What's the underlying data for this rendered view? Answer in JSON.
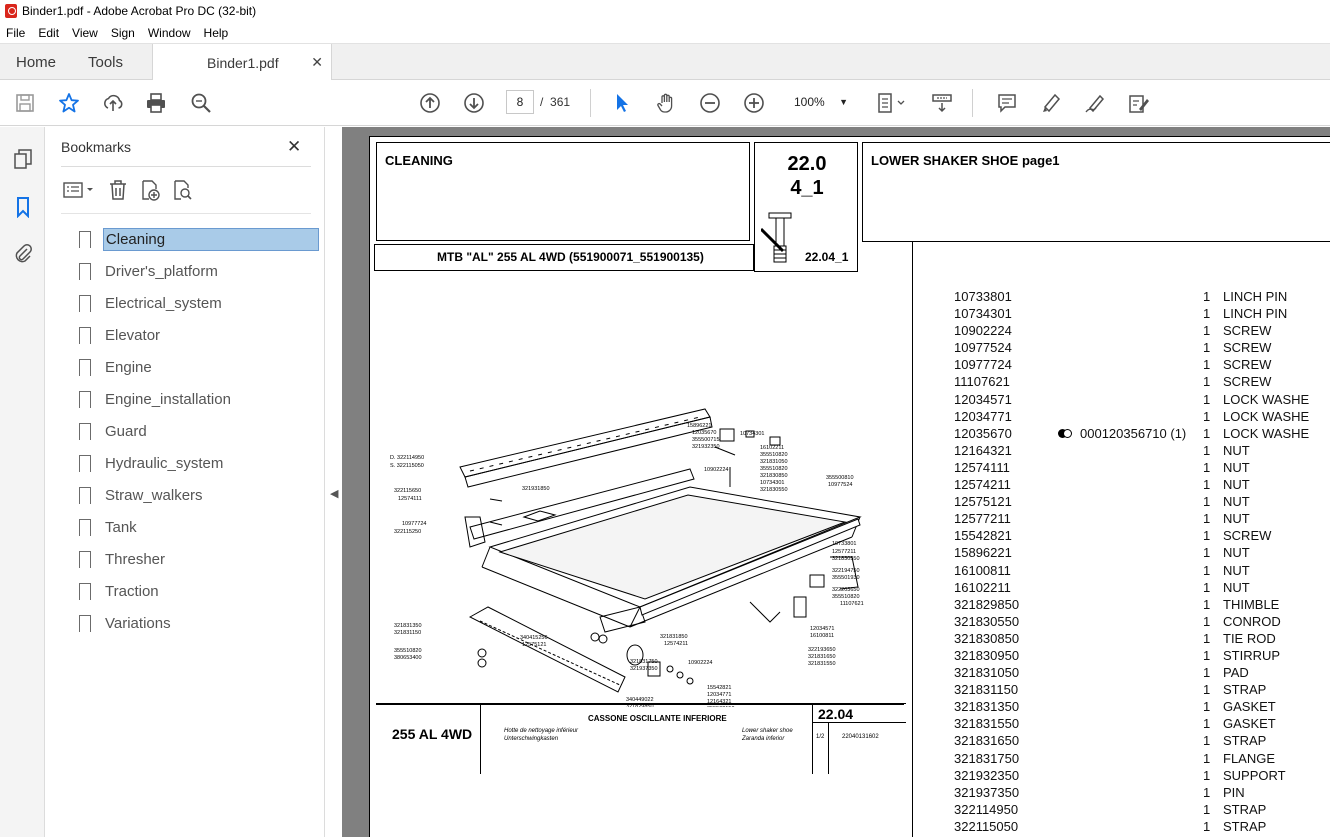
{
  "window": {
    "title": "Binder1.pdf - Adobe Acrobat Pro DC (32-bit)"
  },
  "menu": [
    "File",
    "Edit",
    "View",
    "Sign",
    "Window",
    "Help"
  ],
  "tabs": {
    "home": "Home",
    "tools": "Tools",
    "doc": "Binder1.pdf"
  },
  "toolbar": {
    "page_current": "8",
    "page_sep": "/",
    "page_total": "361",
    "zoom": "100%"
  },
  "bookmarks": {
    "title": "Bookmarks",
    "items": [
      "Cleaning",
      "Driver's_platform",
      "Electrical_system",
      "Elevator",
      "Engine",
      "Engine_installation",
      "Guard",
      "Hydraulic_system",
      "Straw_walkers",
      "Tank",
      "Thresher",
      "Traction",
      "Variations"
    ],
    "selected": 0
  },
  "page": {
    "group": "CLEANING",
    "model_line": "MTB \"AL\" 255 AL 4WD (551900071_551900135)",
    "section_num_1": "22.0",
    "section_num_2": "4_1",
    "section_ref": "22.04_1",
    "assembly": "LOWER SHAKER SHOE  page1",
    "caption": {
      "model": "255 AL 4WD",
      "title": "CASSONE OSCILLANTE INFERIORE",
      "fr": "Hotte de nettoyage inférieur",
      "de": "Unterschwingkasten",
      "en": "Lower shaker shoe",
      "es": "Zaranda inferior",
      "sec": "22.04",
      "sheet": "1/2",
      "code": "22040131602"
    },
    "drawing_labels": [
      "D. 322114950",
      "S. 322115050",
      "15896221",
      "12035670",
      "355500715",
      "321932350",
      "10734301",
      "16102211",
      "355510820",
      "321831050",
      "355510820",
      "321830850",
      "10734301",
      "321830550",
      "10902224",
      "321931850",
      "322115650",
      "12574111",
      "10977724",
      "322115250",
      "355500810",
      "10977524",
      "10733801",
      "12577211",
      "321830550",
      "322194750",
      "355501930",
      "322203650",
      "355510820",
      "11107621",
      "321831350",
      "321831150",
      "355510820",
      "380653400",
      "340415256",
      "12575121",
      "321831850",
      "12574211",
      "321831750",
      "321937350",
      "10902224",
      "12034571",
      "16100811",
      "322193650",
      "321831650",
      "321831550",
      "15542821",
      "12034771",
      "12164321",
      "355502150",
      "340449022",
      "321829850"
    ]
  },
  "parts": [
    {
      "code": "10733801",
      "alt": "",
      "qty": "1",
      "desc": "LINCH PIN"
    },
    {
      "code": "10734301",
      "alt": "",
      "qty": "1",
      "desc": "LINCH PIN"
    },
    {
      "code": "10902224",
      "alt": "",
      "qty": "1",
      "desc": "SCREW"
    },
    {
      "code": "10977524",
      "alt": "",
      "qty": "1",
      "desc": "SCREW"
    },
    {
      "code": "10977724",
      "alt": "",
      "qty": "1",
      "desc": "SCREW"
    },
    {
      "code": "11107621",
      "alt": "",
      "qty": "1",
      "desc": "SCREW"
    },
    {
      "code": "12034571",
      "alt": "",
      "qty": "1",
      "desc": "LOCK WASHE"
    },
    {
      "code": "12034771",
      "alt": "",
      "qty": "1",
      "desc": "LOCK WASHE"
    },
    {
      "code": "12035670",
      "alt": "000120356710  (1)",
      "qty": "1",
      "desc": "LOCK WASHE"
    },
    {
      "code": "12164321",
      "alt": "",
      "qty": "1",
      "desc": "NUT"
    },
    {
      "code": "12574111",
      "alt": "",
      "qty": "1",
      "desc": "NUT"
    },
    {
      "code": "12574211",
      "alt": "",
      "qty": "1",
      "desc": "NUT"
    },
    {
      "code": "12575121",
      "alt": "",
      "qty": "1",
      "desc": "NUT"
    },
    {
      "code": "12577211",
      "alt": "",
      "qty": "1",
      "desc": "NUT"
    },
    {
      "code": "15542821",
      "alt": "",
      "qty": "1",
      "desc": "SCREW"
    },
    {
      "code": "15896221",
      "alt": "",
      "qty": "1",
      "desc": "NUT"
    },
    {
      "code": "16100811",
      "alt": "",
      "qty": "1",
      "desc": "NUT"
    },
    {
      "code": "16102211",
      "alt": "",
      "qty": "1",
      "desc": "NUT"
    },
    {
      "code": "321829850",
      "alt": "",
      "qty": "1",
      "desc": "THIMBLE"
    },
    {
      "code": "321830550",
      "alt": "",
      "qty": "1",
      "desc": "CONROD"
    },
    {
      "code": "321830850",
      "alt": "",
      "qty": "1",
      "desc": "TIE ROD"
    },
    {
      "code": "321830950",
      "alt": "",
      "qty": "1",
      "desc": "STIRRUP"
    },
    {
      "code": "321831050",
      "alt": "",
      "qty": "1",
      "desc": "PAD"
    },
    {
      "code": "321831150",
      "alt": "",
      "qty": "1",
      "desc": "STRAP"
    },
    {
      "code": "321831350",
      "alt": "",
      "qty": "1",
      "desc": "GASKET"
    },
    {
      "code": "321831550",
      "alt": "",
      "qty": "1",
      "desc": "GASKET"
    },
    {
      "code": "321831650",
      "alt": "",
      "qty": "1",
      "desc": "STRAP"
    },
    {
      "code": "321831750",
      "alt": "",
      "qty": "1",
      "desc": "FLANGE"
    },
    {
      "code": "321932350",
      "alt": "",
      "qty": "1",
      "desc": "SUPPORT"
    },
    {
      "code": "321937350",
      "alt": "",
      "qty": "1",
      "desc": "PIN"
    },
    {
      "code": "322114950",
      "alt": "",
      "qty": "1",
      "desc": "STRAP"
    },
    {
      "code": "322115050",
      "alt": "",
      "qty": "1",
      "desc": "STRAP"
    }
  ],
  "icons": {
    "save": "save-icon",
    "star": "bookmark-star-icon",
    "upload": "share-upload-icon",
    "print": "print-icon",
    "find": "search-zoom-icon",
    "prev": "page-up-icon",
    "next": "page-down-icon",
    "select": "select-arrow-icon",
    "hand": "hand-icon",
    "zoomout": "zoom-out-icon",
    "zoomin": "zoom-in-icon",
    "fit": "fit-page-icon",
    "scroll": "scroll-mode-icon",
    "comment": "comment-icon",
    "highlight": "highlight-pen-icon",
    "draw": "draw-icon",
    "edit": "edit-sign-icon"
  },
  "colors": {
    "accent": "#1473e6",
    "selection": "#a9cbe8",
    "doc_bg": "#808080",
    "pdf_red": "#d9261c"
  }
}
